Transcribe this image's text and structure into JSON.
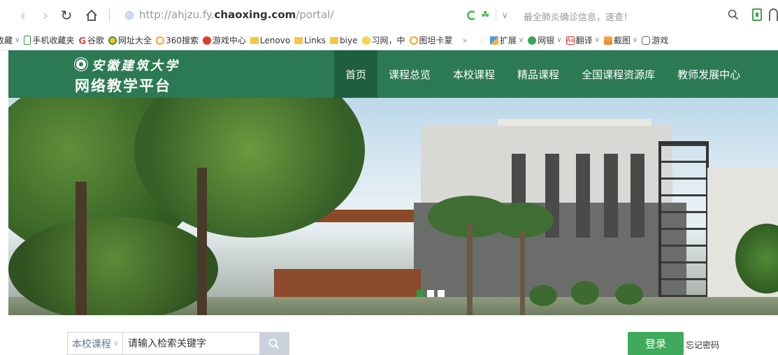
{
  "browser": {
    "url_prefix": "http://ahjzu.fy.",
    "url_domain": "chaoxing.com",
    "url_suffix": "/portal/",
    "news_text": "最全肺炎确诊信息，速查！"
  },
  "bookmarks": [
    {
      "label": "收藏",
      "icon": "none",
      "caret": true
    },
    {
      "label": "手机收藏夹",
      "icon": "phone",
      "caret": false
    },
    {
      "label": "谷歌",
      "icon": "g",
      "caret": false
    },
    {
      "label": "网址大全",
      "icon": "circle-green",
      "caret": false
    },
    {
      "label": "360搜索",
      "icon": "circle-o",
      "caret": false
    },
    {
      "label": "游戏中心",
      "icon": "circle-red",
      "caret": false
    },
    {
      "label": "Lenovo",
      "icon": "folder",
      "caret": false
    },
    {
      "label": "Links",
      "icon": "folder",
      "caret": false
    },
    {
      "label": "biye",
      "icon": "folder",
      "caret": false
    },
    {
      "label": "习网，中",
      "icon": "bee",
      "caret": false
    },
    {
      "label": "图坦卡蒙",
      "icon": "circle-o",
      "caret": false
    }
  ],
  "bookmarks_more": "»",
  "toolbar_extras": [
    {
      "label": "扩展",
      "icon": "tile"
    },
    {
      "label": "网银",
      "icon": "leaf"
    },
    {
      "label": "翻译",
      "icon": "aa"
    },
    {
      "label": "截图",
      "icon": "cut"
    },
    {
      "label": "游戏",
      "icon": "game"
    }
  ],
  "site": {
    "university_name": "安徽建筑大学",
    "platform_name": "网络教学平台",
    "nav": [
      {
        "label": "首页",
        "active": true
      },
      {
        "label": "课程总览",
        "active": false
      },
      {
        "label": "本校课程",
        "active": false
      },
      {
        "label": "精品课程",
        "active": false
      },
      {
        "label": "全国课程资源库",
        "active": false
      },
      {
        "label": "教师发展中心",
        "active": false
      }
    ]
  },
  "banner": {
    "slide_count": 3,
    "active_slide": 1
  },
  "search": {
    "scope": "本校课程",
    "placeholder": "请输入检索关键字"
  },
  "login_label": "登录",
  "forgot_label": "忘记密码",
  "colors": {
    "header_bg": "#2c7a53",
    "nav_active_bg": "#1f5f3e",
    "login_bg": "#3fab5a",
    "slide_active": "#2c9a3c"
  }
}
